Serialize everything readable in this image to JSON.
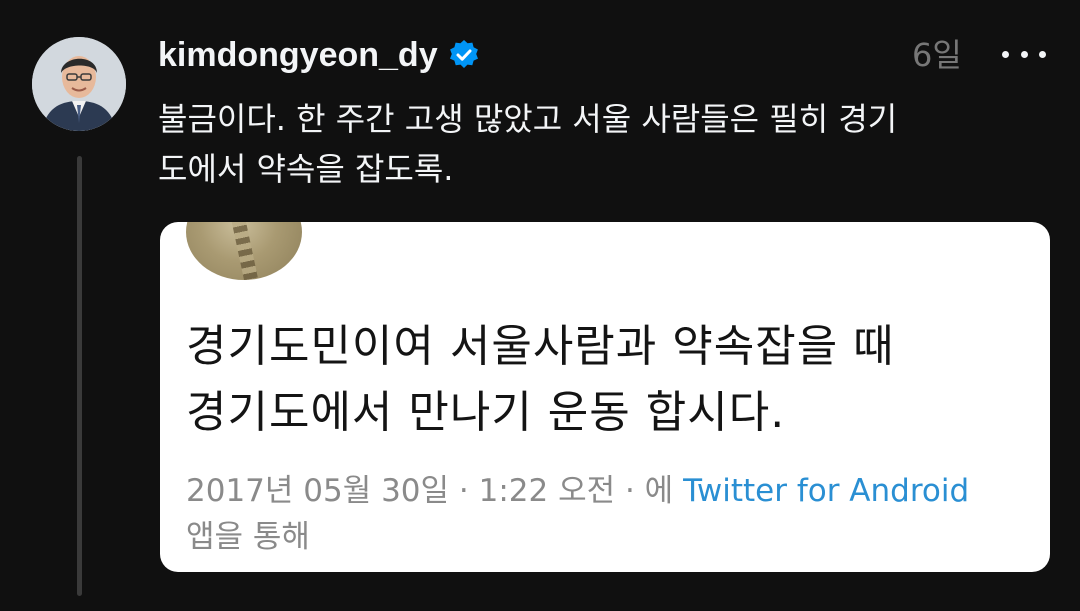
{
  "post": {
    "username": "kimdongyeon_dy",
    "verified": true,
    "timestamp": "6일",
    "more_icon": "more-horizontal-icon",
    "text": "불금이다. 한 주간 고생 많았고 서울 사람들은 필히 경기\n도에서 약속을 잡도록."
  },
  "quoted_tweet": {
    "text": "경기도민이여 서울사람과 약속잡을 때\n경기도에서 만나기 운동 합시다.",
    "meta_prefix": "2017년 05월 30일 · 1:22 오전 · 에 ",
    "meta_link": "Twitter for Android",
    "meta_suffix": "앱을 통해"
  },
  "colors": {
    "background": "#101010",
    "text_primary": "#f3f5f7",
    "text_secondary": "#777777",
    "verified": "#0095f6",
    "link": "#2a8fd3",
    "card_background": "#ffffff"
  }
}
